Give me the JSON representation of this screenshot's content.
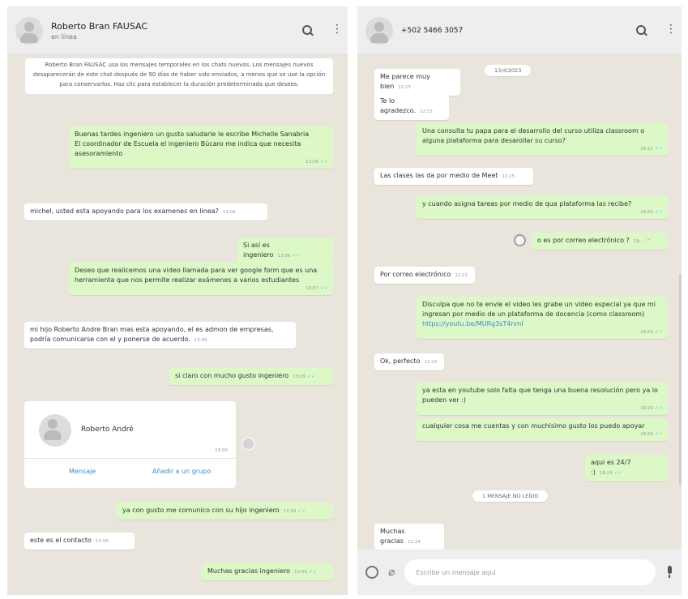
{
  "left_chat": {
    "contact_name": "Roberto Bran FAUSAC",
    "status": "en línea",
    "notice": "Roberto Bran FAUSAC usa los mensajes temporales en los chats nuevos. Los mensajes nuevos desaparecerán de este chat después de 90 días de haber sido enviados, a menos que se use la opción para conservarlos. Haz clic para establecer la duración predeterminada que desees.",
    "messages": [
      {
        "text": "Buenas tardes ingeniero un gusto saludarle le escribe Michelle Sanabria\nEl coordinador de Escuela el ingeniero Búcaro me indica que necesita asesoramiento",
        "time": "13:05"
      },
      {
        "text": "michel, usted esta apoyando para los examenes en linea?",
        "time": "13:06"
      },
      {
        "text": "Si así es ingeniero",
        "time": "13:06"
      },
      {
        "text": "Deseo que realicemos una video llamada para ver google form que es una herramienta que nos permite realizar exámenes a varios estudiantes",
        "time": "13:07"
      },
      {
        "text": "mi hijo Roberto Andre Bran  mas esta apoyando, el es admon de empresas, podría comunicarse con el y ponerse de acuerdo.",
        "time": "13:09"
      },
      {
        "text": "si claro con mucho gusto ingeniero",
        "time": "13:09"
      },
      {
        "text": "ya con gusto me comunico con su hijo ingeniero",
        "time": "13:09"
      },
      {
        "text": "este es el contacto",
        "time": "13:09"
      },
      {
        "text": "Muchas gracias ingeniero",
        "time": "13:09"
      }
    ],
    "contact_card": {
      "name": "Roberto André",
      "time": "13:09",
      "message_btn": "Mensaje",
      "add_group_btn": "Añadir a un grupo"
    }
  },
  "right_chat": {
    "phone": "+502 5466 3057",
    "date_pill": "13/4/2023",
    "unread_pill": "1 MENSAJE NO LEÍDO",
    "input_placeholder": "Escribe un mensaje aquí",
    "messages": [
      {
        "text": "Me parece muy bien",
        "time": "12:15"
      },
      {
        "text": "Te lo agradezco.",
        "time": "12:15"
      },
      {
        "text": "Una consulta tu papa para el desarrollo del curso utiliza classroom o alguna plataforma para desarollar su curso?",
        "time": "18:15"
      },
      {
        "text": "Las clases las da por medio de Meet",
        "time": "12:15"
      },
      {
        "text": "y cuando asigna tareas por medio de qua plataforma las recibe?",
        "time": "18:20"
      },
      {
        "text": "o es por correo electrónico ?",
        "time": "18:..."
      },
      {
        "text": "Por correo electrónico",
        "time": "12:21"
      },
      {
        "text": "Disculpa que no te envie el video les grabe un video especial ya que mi ingresan por medio de un plataforma de docencia (como classroom)",
        "link": "https://youtu.be/MURg3sT4nmI",
        "time": "18:23"
      },
      {
        "text": "Ok, perfecto",
        "time": "12:23"
      },
      {
        "text": "ya esta en youtube solo falta que tenga una buena resolución pero ya lo pueden ver :)",
        "time": "18:23"
      },
      {
        "text": "cualquier cosa me cuentas y con muchisimo gusto los puedo apoyar",
        "time": "18:24"
      },
      {
        "text": "aqui es 24/7 :)",
        "time": "18:24"
      },
      {
        "text": "Muchas gracias",
        "time": "12:24"
      }
    ]
  },
  "colors": {
    "incoming": "#ffffff",
    "outgoing": "#dcf8c6",
    "background": "#e9e5dc",
    "header": "#eeeeee",
    "link": "#3a8bc9"
  }
}
